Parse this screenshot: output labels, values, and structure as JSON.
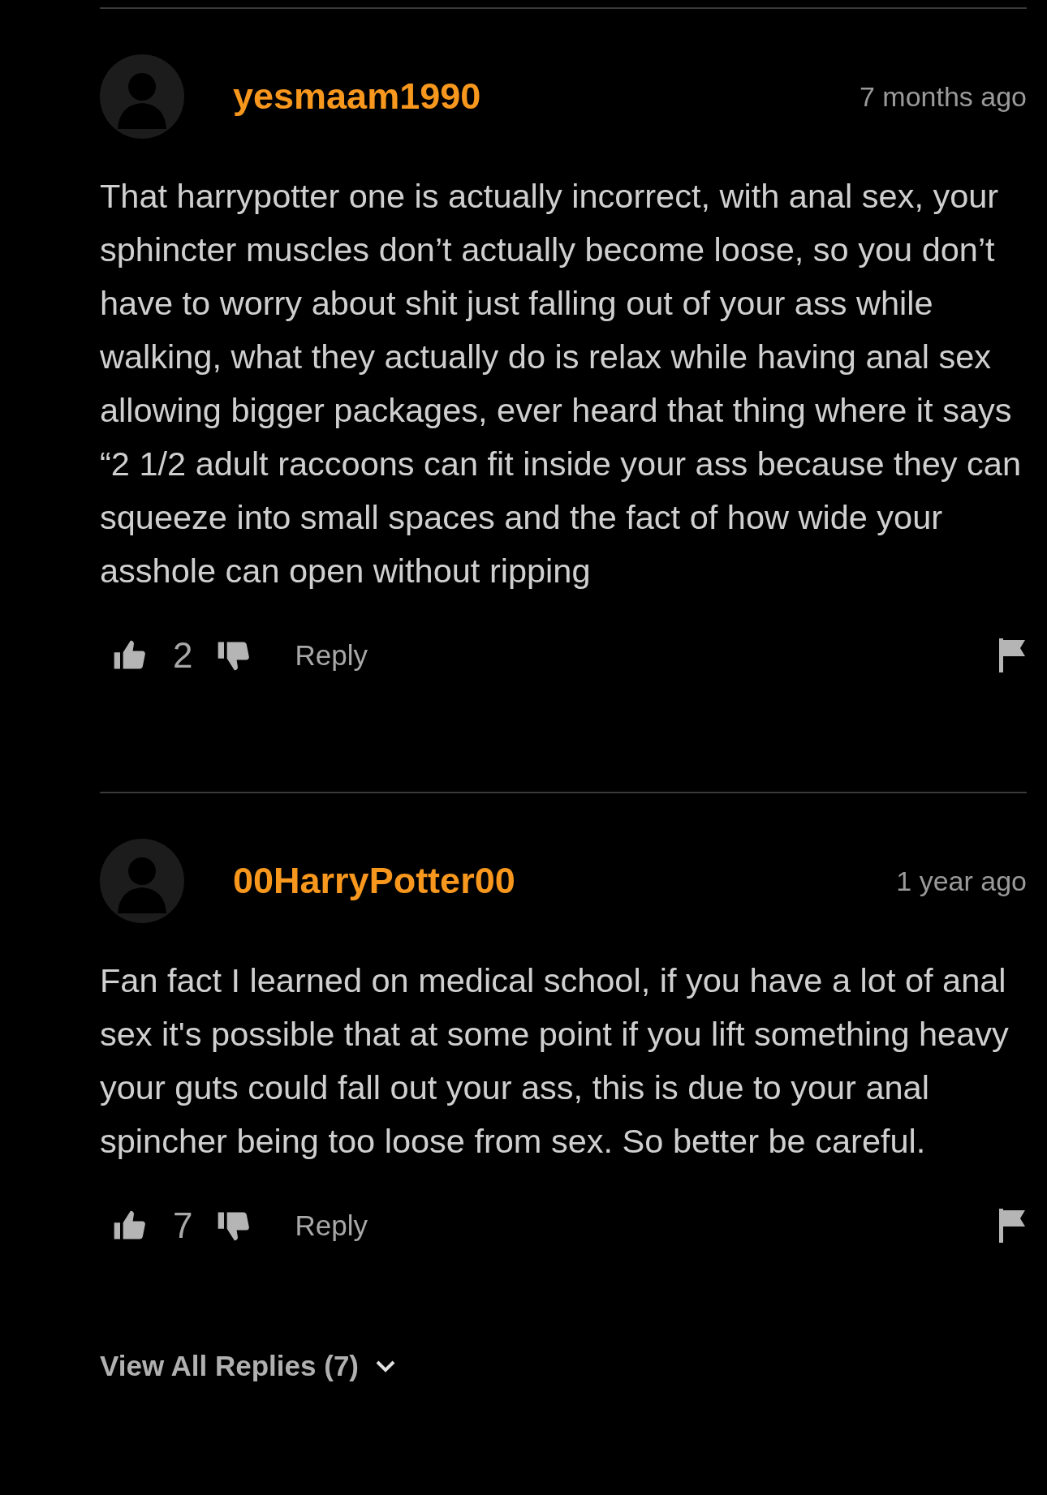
{
  "comments": [
    {
      "username": "yesmaam1990",
      "time": "7 months ago",
      "body": "That harrypotter one is actually incorrect, with anal sex, your sphincter muscles don’t actually become loose, so you don’t have to worry about shit just falling out of your ass while walking, what they actually do is relax while having anal sex allowing bigger packages, ever heard that thing where it says “2 1/2 adult raccoons can fit inside your ass because they can squeeze into small spaces and the fact of how wide your asshole can open without ripping",
      "likes": "2",
      "reply": "Reply"
    },
    {
      "username": "00HarryPotter00",
      "time": "1 year ago",
      "body": "Fan fact I learned on medical school, if you have a lot of anal sex it's possible that at some point if you lift something heavy your guts could fall out your ass, this is due to your anal spincher being too loose from sex. So better be careful.",
      "likes": "7",
      "reply": "Reply"
    }
  ],
  "view_all": "View All Replies (7)"
}
